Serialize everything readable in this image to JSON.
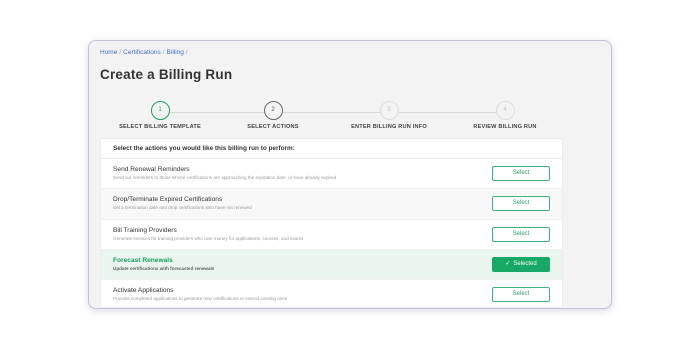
{
  "breadcrumb": [
    "Home",
    "Certifications",
    "Billing"
  ],
  "page_title": "Create a Billing Run",
  "steps": [
    {
      "number": "1",
      "label": "SELECT BILLING TEMPLATE",
      "state": "active"
    },
    {
      "number": "2",
      "label": "SELECT ACTIONS",
      "state": "current"
    },
    {
      "number": "3",
      "label": "ENTER BILLING RUN INFO",
      "state": "pending"
    },
    {
      "number": "4",
      "label": "REVIEW BILLING RUN",
      "state": "pending"
    }
  ],
  "panel": {
    "heading": "Select the actions you would like this billing run to perform:",
    "actions": [
      {
        "title": "Send Renewal Reminders",
        "description": "Send out reminders to those whose certifications are approaching the expiration date, or have already expired",
        "button": "Select",
        "selected": false
      },
      {
        "title": "Drop/Terminate Expired Certifications",
        "description": "Set a termination date and drop certifications who have not renewed",
        "button": "Select",
        "selected": false
      },
      {
        "title": "Bill Training Providers",
        "description": "Generate invoices for training providers who owe money for applications, courses, and exams",
        "button": "Select",
        "selected": false
      },
      {
        "title": "Forecast Renewals",
        "description": "Update certifications with forecasted renewals",
        "button": "Selected",
        "selected": true
      },
      {
        "title": "Activate Applications",
        "description": "Process completed applications to generate new certifications or extend existing ones",
        "button": "Select",
        "selected": false
      }
    ]
  },
  "colors": {
    "accent_green": "#16a864",
    "link_blue": "#3d72c6",
    "frame_border": "#c7c1d8"
  },
  "icons": {
    "selected_check": "check-icon"
  }
}
